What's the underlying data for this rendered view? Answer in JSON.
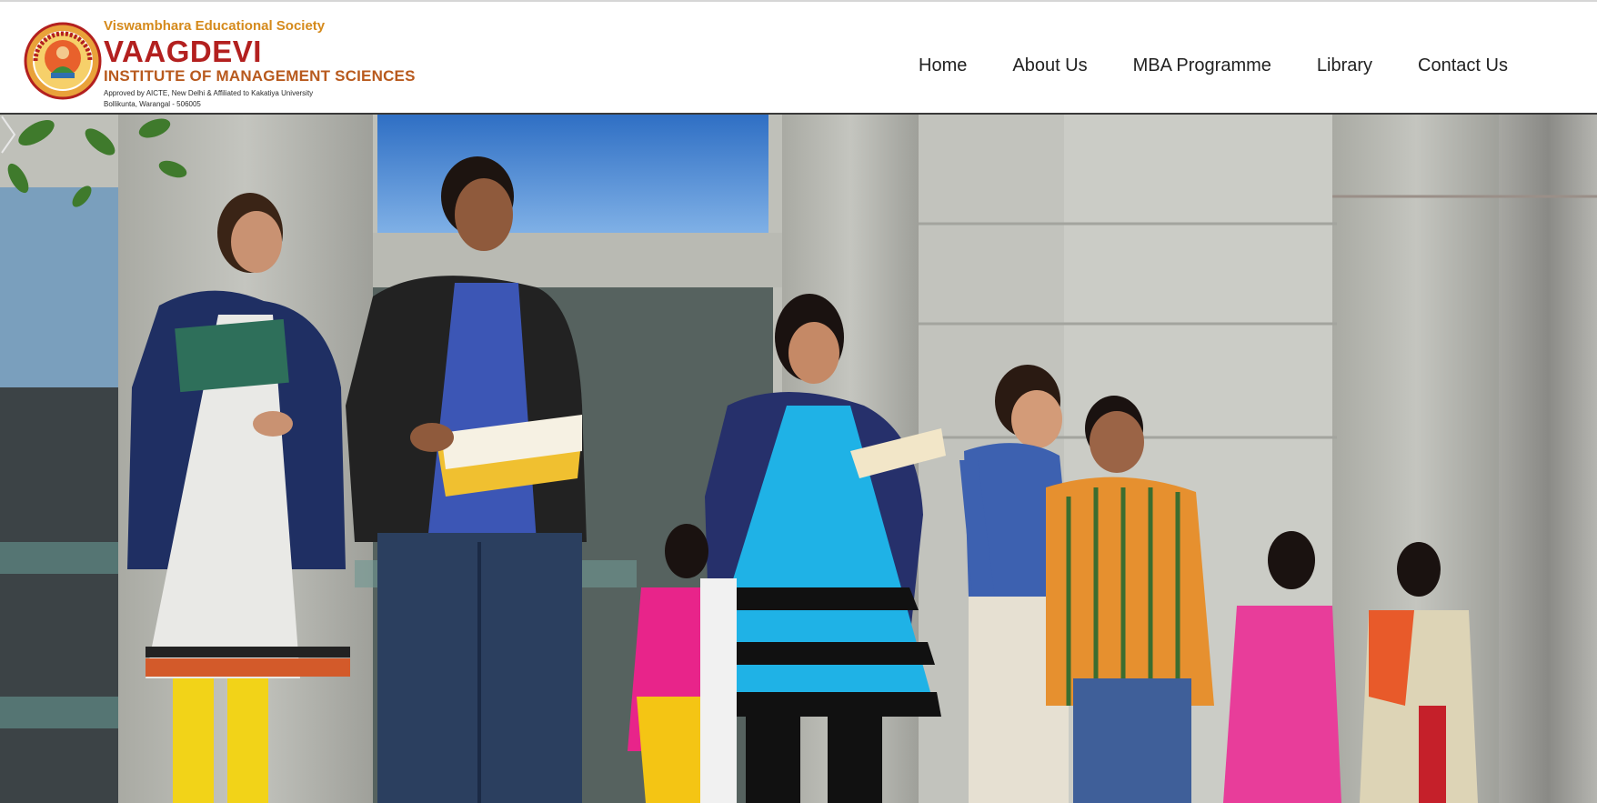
{
  "header": {
    "society": "Viswambhara Educational Society",
    "institute_name": "VAAGDEVI",
    "institute_subtitle": "INSTITUTE OF MANAGEMENT SCIENCES",
    "approval": "Approved by AICTE, New Delhi & Affiliated to Kakatiya University",
    "address": "Bollikunta, Warangal - 506005",
    "seal_text": "VAAGDEVI COLLEGES",
    "logo_icon": "vaagdevi-seal-logo"
  },
  "nav": {
    "items": [
      {
        "label": "Home"
      },
      {
        "label": "About Us"
      },
      {
        "label": "MBA Programme"
      },
      {
        "label": "Library"
      },
      {
        "label": "Contact Us"
      }
    ]
  },
  "hero": {
    "image": "campus-students-photo",
    "next_icon": "chevron-right-icon"
  },
  "colors": {
    "brand_red": "#b3201f",
    "brand_orange": "#d58a1c",
    "nav_text": "#222222",
    "header_border": "#3a3a3a"
  }
}
